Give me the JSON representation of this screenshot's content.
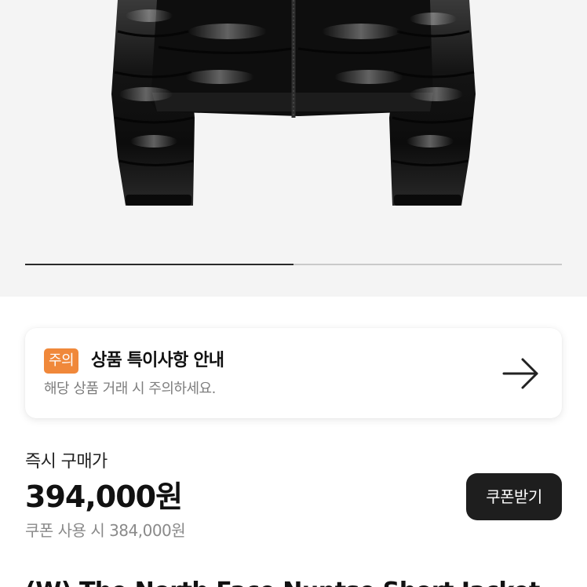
{
  "product_image": {
    "icon": "black-puffer-jacket-image",
    "slide_progress_fraction": 0.5
  },
  "notice": {
    "badge": "주의",
    "title": "상품 특이사항 안내",
    "description": "해당 상품 거래 시 주의하세요.",
    "icon": "arrow-right-icon",
    "badge_color": "#f0883a"
  },
  "pricing": {
    "label": "즉시 구매가",
    "price": "394,000원",
    "coupon_price_text": "쿠폰 사용 시 384,000원",
    "coupon_button_label": "쿠폰받기"
  },
  "product": {
    "title": "(W) The North Face Nuptse Short Jacket"
  }
}
